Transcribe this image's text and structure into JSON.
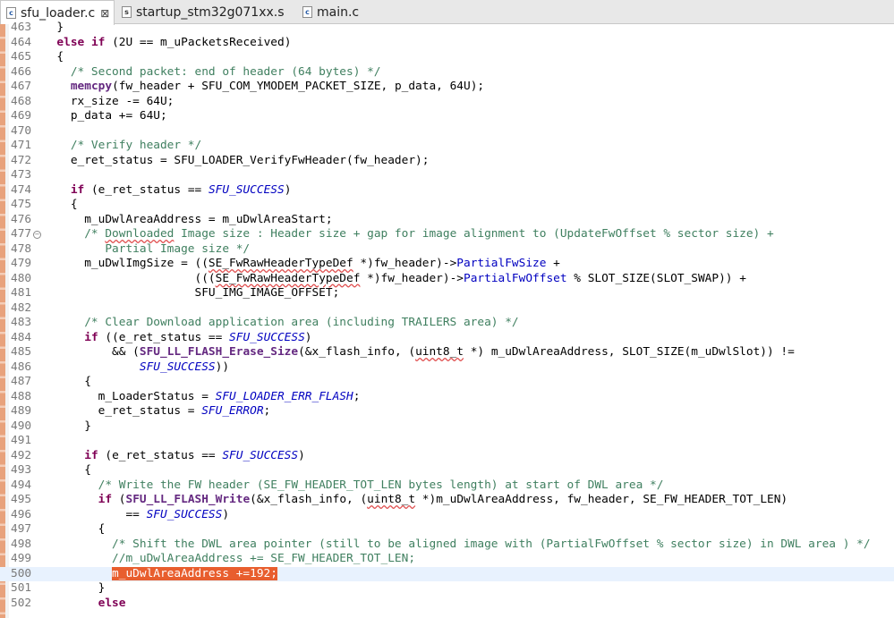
{
  "tabs": [
    {
      "label": "sfu_loader.c",
      "icon": "c-file-icon",
      "active": true,
      "closable": true
    },
    {
      "label": "startup_stm32g071xx.s",
      "icon": "asm-file-icon",
      "active": false
    },
    {
      "label": "main.c",
      "icon": "c-file-icon",
      "active": false
    }
  ],
  "lines": [
    {
      "num": "463",
      "code": "  }"
    },
    {
      "num": "464",
      "code": "  else if (2U == m_uPacketsReceived)"
    },
    {
      "num": "465",
      "code": "  {"
    },
    {
      "num": "466",
      "code": "    /* Second packet: end of header (64 bytes) */"
    },
    {
      "num": "467",
      "code": "    memcpy(fw_header + SFU_COM_YMODEM_PACKET_SIZE, p_data, 64U);"
    },
    {
      "num": "468",
      "code": "    rx_size -= 64U;"
    },
    {
      "num": "469",
      "code": "    p_data += 64U;"
    },
    {
      "num": "470",
      "code": ""
    },
    {
      "num": "471",
      "code": "    /* Verify header */"
    },
    {
      "num": "472",
      "code": "    e_ret_status = SFU_LOADER_VerifyFwHeader(fw_header);"
    },
    {
      "num": "473",
      "code": ""
    },
    {
      "num": "474",
      "code": "    if (e_ret_status == SFU_SUCCESS)"
    },
    {
      "num": "475",
      "code": "    {"
    },
    {
      "num": "476",
      "code": "      m_uDwlAreaAddress = m_uDwlAreaStart;"
    },
    {
      "num": "477",
      "code": "      /* Downloaded Image size : Header size + gap for image alignment to (UpdateFwOffset % sector size) +",
      "fold": true
    },
    {
      "num": "478",
      "code": "         Partial Image size */"
    },
    {
      "num": "479",
      "code": "      m_uDwlImgSize = ((SE_FwRawHeaderTypeDef *)fw_header)->PartialFwSize +"
    },
    {
      "num": "480",
      "code": "                      (((SE_FwRawHeaderTypeDef *)fw_header)->PartialFwOffset % SLOT_SIZE(SLOT_SWAP)) +"
    },
    {
      "num": "481",
      "code": "                      SFU_IMG_IMAGE_OFFSET;"
    },
    {
      "num": "482",
      "code": ""
    },
    {
      "num": "483",
      "code": "      /* Clear Download application area (including TRAILERS area) */"
    },
    {
      "num": "484",
      "code": "      if ((e_ret_status == SFU_SUCCESS)"
    },
    {
      "num": "485",
      "code": "          && (SFU_LL_FLASH_Erase_Size(&x_flash_info, (uint8_t *) m_uDwlAreaAddress, SLOT_SIZE(m_uDwlSlot)) !="
    },
    {
      "num": "486",
      "code": "              SFU_SUCCESS))"
    },
    {
      "num": "487",
      "code": "      {"
    },
    {
      "num": "488",
      "code": "        m_LoaderStatus = SFU_LOADER_ERR_FLASH;"
    },
    {
      "num": "489",
      "code": "        e_ret_status = SFU_ERROR;"
    },
    {
      "num": "490",
      "code": "      }"
    },
    {
      "num": "491",
      "code": ""
    },
    {
      "num": "492",
      "code": "      if (e_ret_status == SFU_SUCCESS)"
    },
    {
      "num": "493",
      "code": "      {"
    },
    {
      "num": "494",
      "code": "        /* Write the FW header (SE_FW_HEADER_TOT_LEN bytes length) at start of DWL area */"
    },
    {
      "num": "495",
      "code": "        if (SFU_LL_FLASH_Write(&x_flash_info, (uint8_t *)m_uDwlAreaAddress, fw_header, SE_FW_HEADER_TOT_LEN)"
    },
    {
      "num": "496",
      "code": "            == SFU_SUCCESS)"
    },
    {
      "num": "497",
      "code": "        {"
    },
    {
      "num": "498",
      "code": "          /* Shift the DWL area pointer (still to be aligned image with (PartialFwOffset % sector size) in DWL area ) */"
    },
    {
      "num": "499",
      "code": "          //m_uDwlAreaAddress += SE_FW_HEADER_TOT_LEN;"
    },
    {
      "num": "500",
      "code": "          m_uDwlAreaAddress +=192;",
      "current": true,
      "selected": "m_uDwlAreaAddress +=192;"
    },
    {
      "num": "501",
      "code": "        }"
    },
    {
      "num": "502",
      "code": "        else"
    }
  ],
  "syntax": {
    "keywords": [
      "else",
      "if"
    ],
    "functions": [
      "memcpy",
      "SFU_LL_FLASH_Erase_Size",
      "SFU_LL_FLASH_Write"
    ],
    "enums": [
      "SFU_SUCCESS",
      "SFU_ERROR",
      "SFU_LOADER_ERR_FLASH"
    ],
    "fields": [
      "PartialFwSize",
      "PartialFwOffset"
    ],
    "squiggled": [
      "Downloaded",
      "SE_FwRawHeaderTypeDef",
      "uint8_t"
    ]
  },
  "colors": {
    "keyword": "#7f0055",
    "comment": "#3f7f5f",
    "enum": "#0000c0",
    "selection": "#e85e2e",
    "current_line": "#e8f2fe",
    "change_marker": "#e8a27c"
  }
}
